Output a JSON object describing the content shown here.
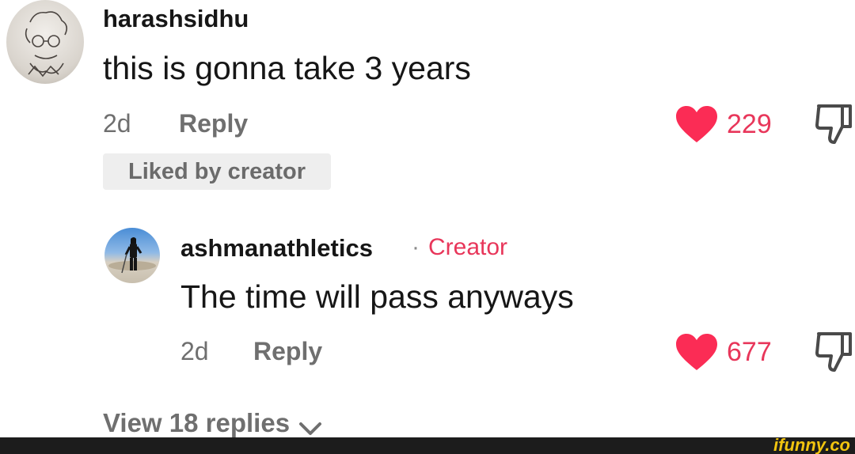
{
  "comment": {
    "username": "harashsidhu",
    "text": "this is gonna take 3 years",
    "time": "2d",
    "reply_label": "Reply",
    "like_count": "229",
    "liked_badge": "Liked by creator"
  },
  "reply": {
    "username": "ashmanathletics",
    "separator": "·",
    "creator_tag": "Creator",
    "text": "The time will pass anyways",
    "time": "2d",
    "reply_label": "Reply",
    "like_count": "677"
  },
  "view_replies": {
    "label": "View 18 replies",
    "icon": "chevron-down-icon"
  },
  "colors": {
    "heart": "#fb2c55",
    "creator": "#e8365a",
    "watermark": "#f1c40f"
  },
  "watermark": {
    "text": "ifunny.co"
  }
}
